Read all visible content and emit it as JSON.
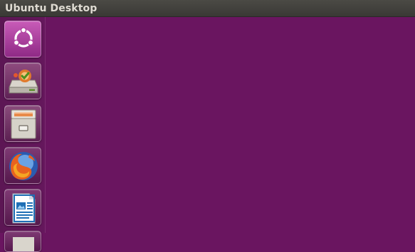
{
  "window": {
    "title": "Ubuntu Desktop"
  },
  "launcher": {
    "items": [
      {
        "icon": "ubuntu-logo-icon",
        "tooltip": ""
      },
      {
        "icon": "software-center-icon",
        "tooltip": ""
      },
      {
        "icon": "file-cabinet-icon",
        "tooltip": ""
      },
      {
        "icon": "firefox-icon",
        "tooltip": ""
      },
      {
        "icon": "libreoffice-writer-icon",
        "tooltip": ""
      },
      {
        "icon": "partial-launcher-icon",
        "tooltip": ""
      }
    ]
  },
  "colors": {
    "desktop_background": "#6a1560",
    "topbar": "#3f3e3a",
    "title_text": "#dfdbd2"
  }
}
